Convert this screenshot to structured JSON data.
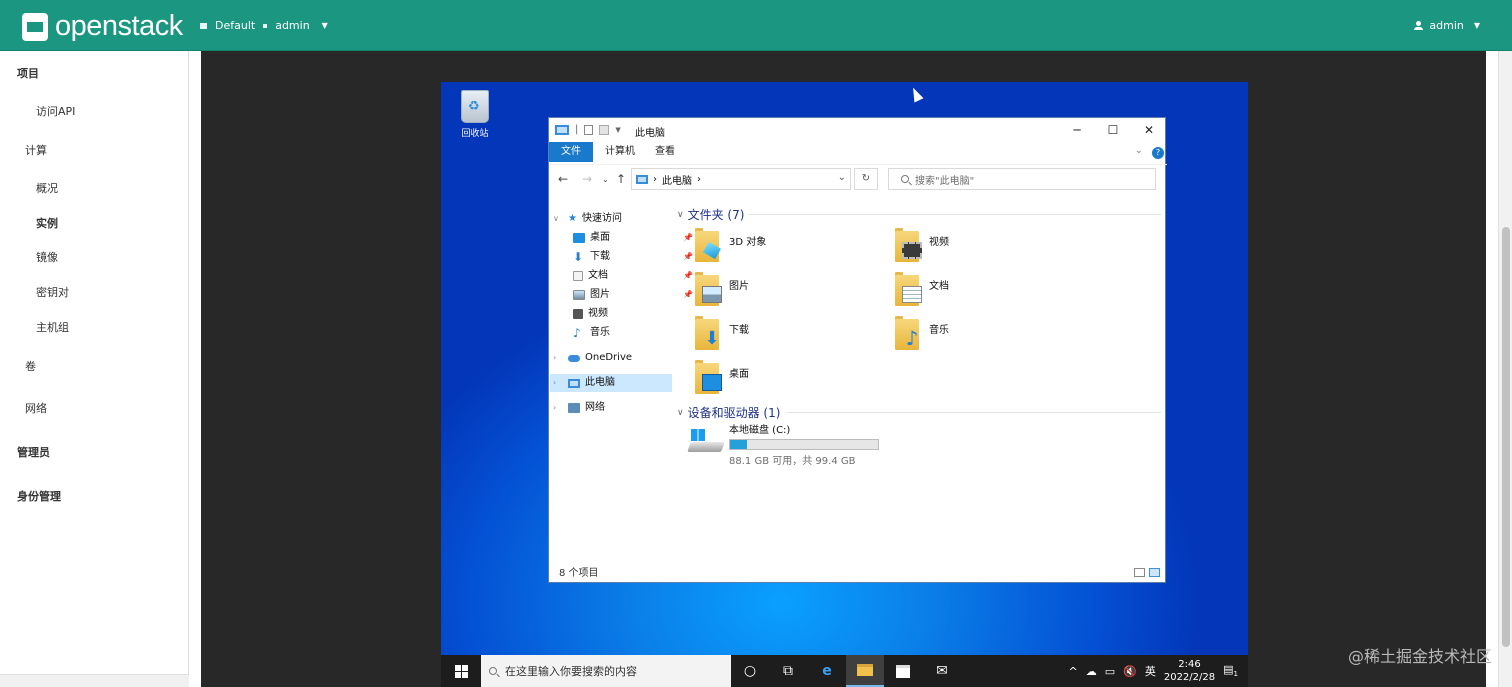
{
  "brand": {
    "name": "openstack"
  },
  "header": {
    "domain": "Default",
    "project": "admin",
    "user": "admin"
  },
  "sidebar": {
    "items": [
      {
        "label": "项目",
        "bold": true
      },
      {
        "label": "访问API"
      },
      {
        "label": "计算"
      },
      {
        "label": "概况"
      },
      {
        "label": "实例",
        "bold": true
      },
      {
        "label": "镜像"
      },
      {
        "label": "密钥对"
      },
      {
        "label": "主机组"
      },
      {
        "label": "卷"
      },
      {
        "label": "网络"
      },
      {
        "label": "管理员",
        "bold": true
      },
      {
        "label": "身份管理",
        "bold": true
      }
    ]
  },
  "desktop": {
    "recycle_label": "回收站"
  },
  "explorer": {
    "title": "此电脑",
    "tabs": [
      "文件",
      "计算机",
      "查看"
    ],
    "address": "此电脑",
    "search_placeholder": "搜索\"此电脑\"",
    "tree": {
      "quick_access": "快速访问",
      "quick_items": [
        "桌面",
        "下载",
        "文档",
        "图片",
        "视频",
        "音乐"
      ],
      "onedrive": "OneDrive",
      "this_pc": "此电脑",
      "network": "网络"
    },
    "folders_header": "文件夹 (7)",
    "folders": [
      "3D 对象",
      "视频",
      "图片",
      "文档",
      "下载",
      "音乐",
      "桌面"
    ],
    "devices_header": "设备和驱动器 (1)",
    "drive": {
      "name": "本地磁盘 (C:)",
      "info": "88.1 GB 可用，共 99.4 GB",
      "used_fraction": 0.114
    },
    "status": "8 个项目"
  },
  "taskbar": {
    "search_placeholder": "在这里输入你要搜索的内容",
    "ime": "英",
    "time": "2:46",
    "date": "2022/2/28",
    "notif_count": "1"
  },
  "watermark": "@稀土掘金技术社区",
  "colors": {
    "header": "#1b9681",
    "accent": "#1979ca"
  }
}
